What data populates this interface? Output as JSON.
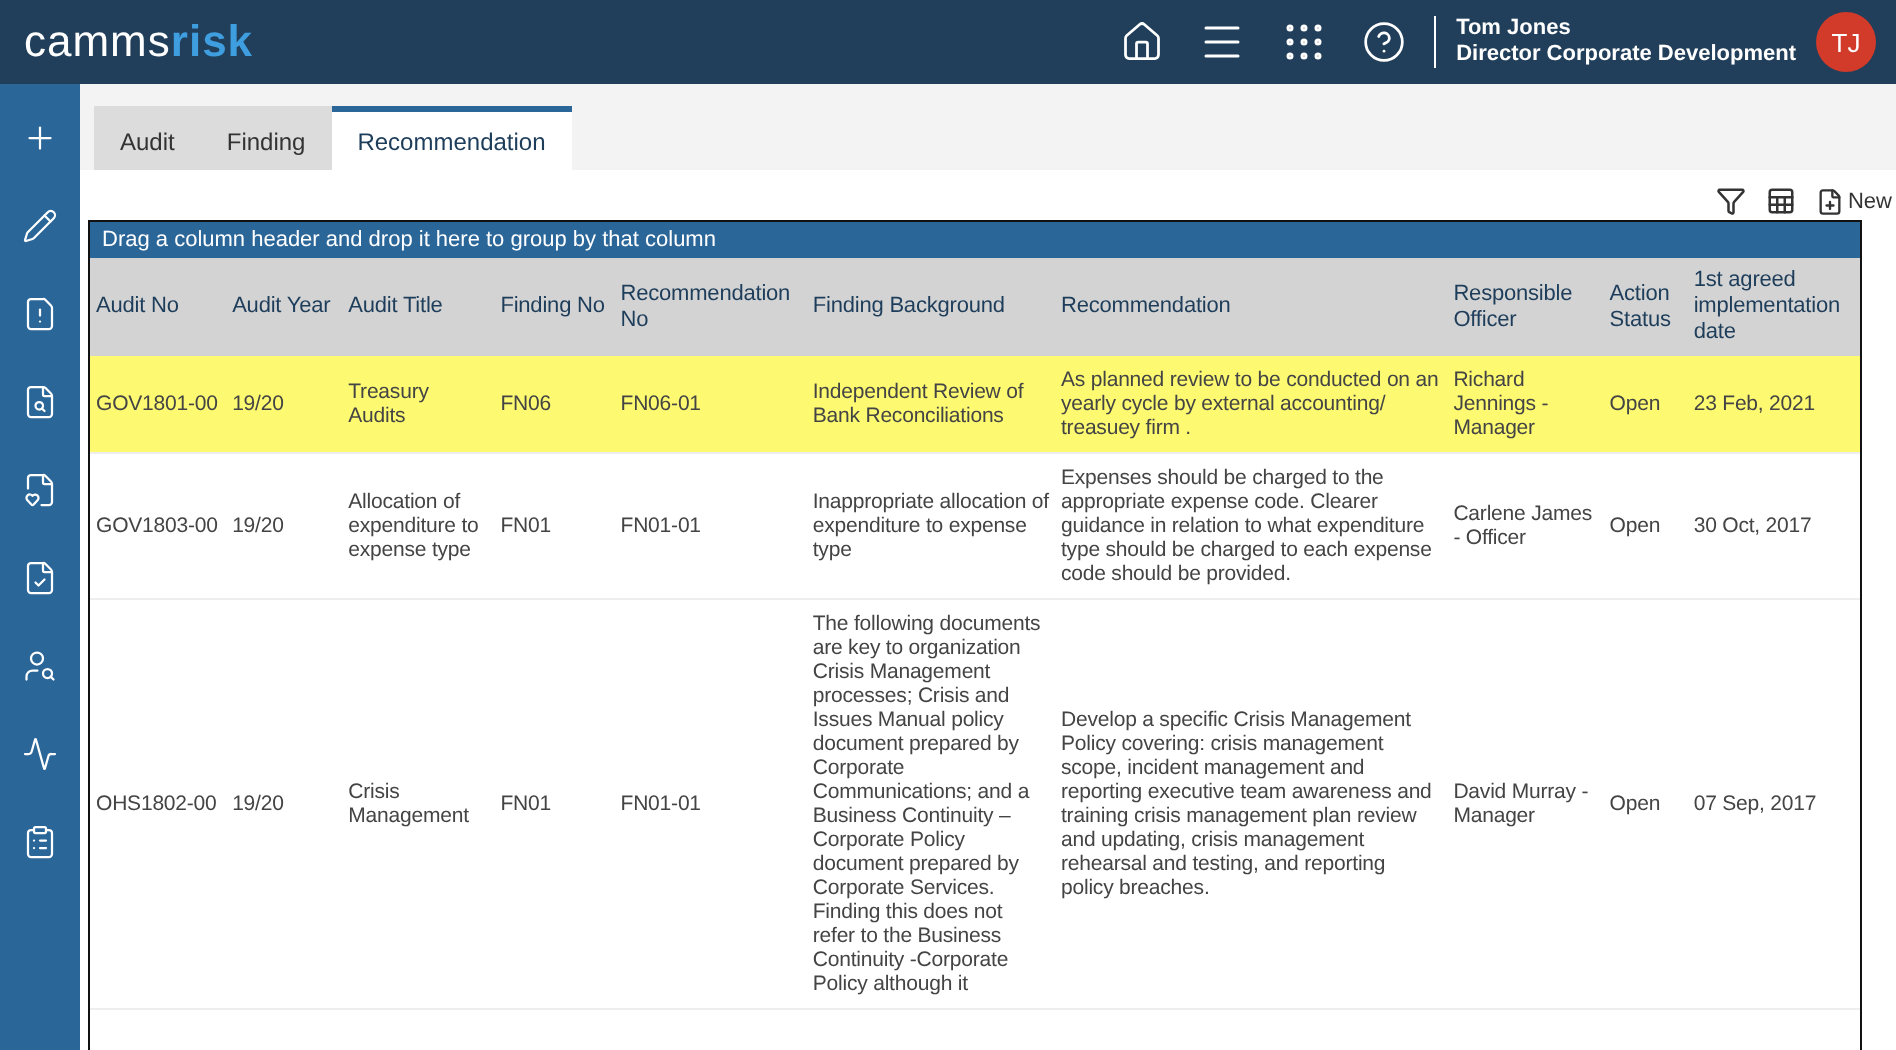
{
  "header": {
    "logo_left": "camms",
    "logo_right": "risk",
    "user_name": "Tom Jones",
    "user_role": "Director Corporate Development",
    "avatar": "TJ"
  },
  "tabs": [
    {
      "label": "Audit",
      "selected": false
    },
    {
      "label": "Finding",
      "selected": false
    },
    {
      "label": "Recommendation",
      "selected": true
    }
  ],
  "toolbar": {
    "new_label": "New"
  },
  "grid": {
    "group_hint": "Drag a column header and drop it here to group by that column",
    "columns": [
      "Audit No",
      "Audit Year",
      "Audit Title",
      "Finding No",
      "Recommendation No",
      "Finding Background",
      "Recommendation",
      "Responsible Officer",
      "Action Status",
      "1st agreed implementation date"
    ],
    "rows": [
      {
        "selected": true,
        "cells": [
          "GOV1801-00",
          "19/20",
          "Treasury Audits",
          "FN06",
          "FN06-01",
          "Independent Review of Bank Reconciliations",
          "As planned review to be conducted on an yearly cycle by external accounting/ treasuey firm .",
          "Richard Jennings - Manager",
          "Open",
          "23 Feb, 2021"
        ]
      },
      {
        "selected": false,
        "cells": [
          "GOV1803-00",
          "19/20",
          "Allocation of expenditure to expense type",
          "FN01",
          "FN01-01",
          "Inappropriate allocation of expenditure to expense type",
          "Expenses should be charged to the appropriate expense code. Clearer guidance in relation to what expenditure type should be charged to each expense code should be provided.",
          "Carlene James - Officer",
          "Open",
          "30 Oct, 2017"
        ]
      },
      {
        "selected": false,
        "cells": [
          "OHS1802-00",
          "19/20",
          "Crisis Management",
          "FN01",
          "FN01-01",
          "The following documents are key to organization Crisis Management processes; Crisis and Issues Manual policy document prepared by Corporate Communications; and a Business Continuity – Corporate Policy document prepared by Corporate Services. Finding this does not refer to the Business Continuity -Corporate Policy although it",
          "Develop a specific Crisis Management Policy covering: crisis management scope, incident management and reporting executive team awareness and training crisis management plan review and updating, crisis management rehearsal and testing, and reporting policy breaches.",
          "David Murray - Manager",
          "Open",
          "07 Sep, 2017"
        ]
      }
    ]
  }
}
